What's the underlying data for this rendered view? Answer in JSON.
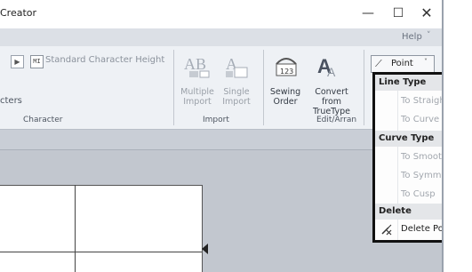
{
  "window": {
    "title": "Creator",
    "help": "Help",
    "help_chevron": "˅",
    "minimize": "—",
    "maximize": "☐",
    "close": "✕"
  },
  "ribbon": {
    "character_group": {
      "standard_height_label": "Standard Character Height",
      "characters_label": "cters",
      "group_label": "Character",
      "mi_icon": "MI"
    },
    "import_group": {
      "multiple_import": [
        "Multiple",
        "Import"
      ],
      "single_import": [
        "Single",
        "Import"
      ],
      "group_label": "Import"
    },
    "edit_group": {
      "sewing_order": [
        "Sewing",
        "Order"
      ],
      "convert_truetype": [
        "Convert from",
        "TrueType"
      ],
      "group_label": "Edit/Arran"
    },
    "point_button": {
      "label": "Point",
      "chevron": "˅"
    }
  },
  "menu": {
    "sections": [
      {
        "header": "Line Type",
        "items": [
          {
            "label": "To Straight",
            "enabled": false
          },
          {
            "label": "To Curve",
            "enabled": false
          }
        ]
      },
      {
        "header": "Curve Type",
        "items": [
          {
            "label": "To Smooth",
            "enabled": false
          },
          {
            "label": "To Symmetry",
            "enabled": false
          },
          {
            "label": "To Cusp",
            "enabled": false
          }
        ]
      },
      {
        "header": "Delete",
        "items": [
          {
            "label": "Delete Point",
            "enabled": true
          }
        ]
      }
    ]
  },
  "colors": {
    "menu_border": "#111111",
    "disabled_text": "#a2a7ae",
    "ribbon_bg": "#eef1f5"
  }
}
